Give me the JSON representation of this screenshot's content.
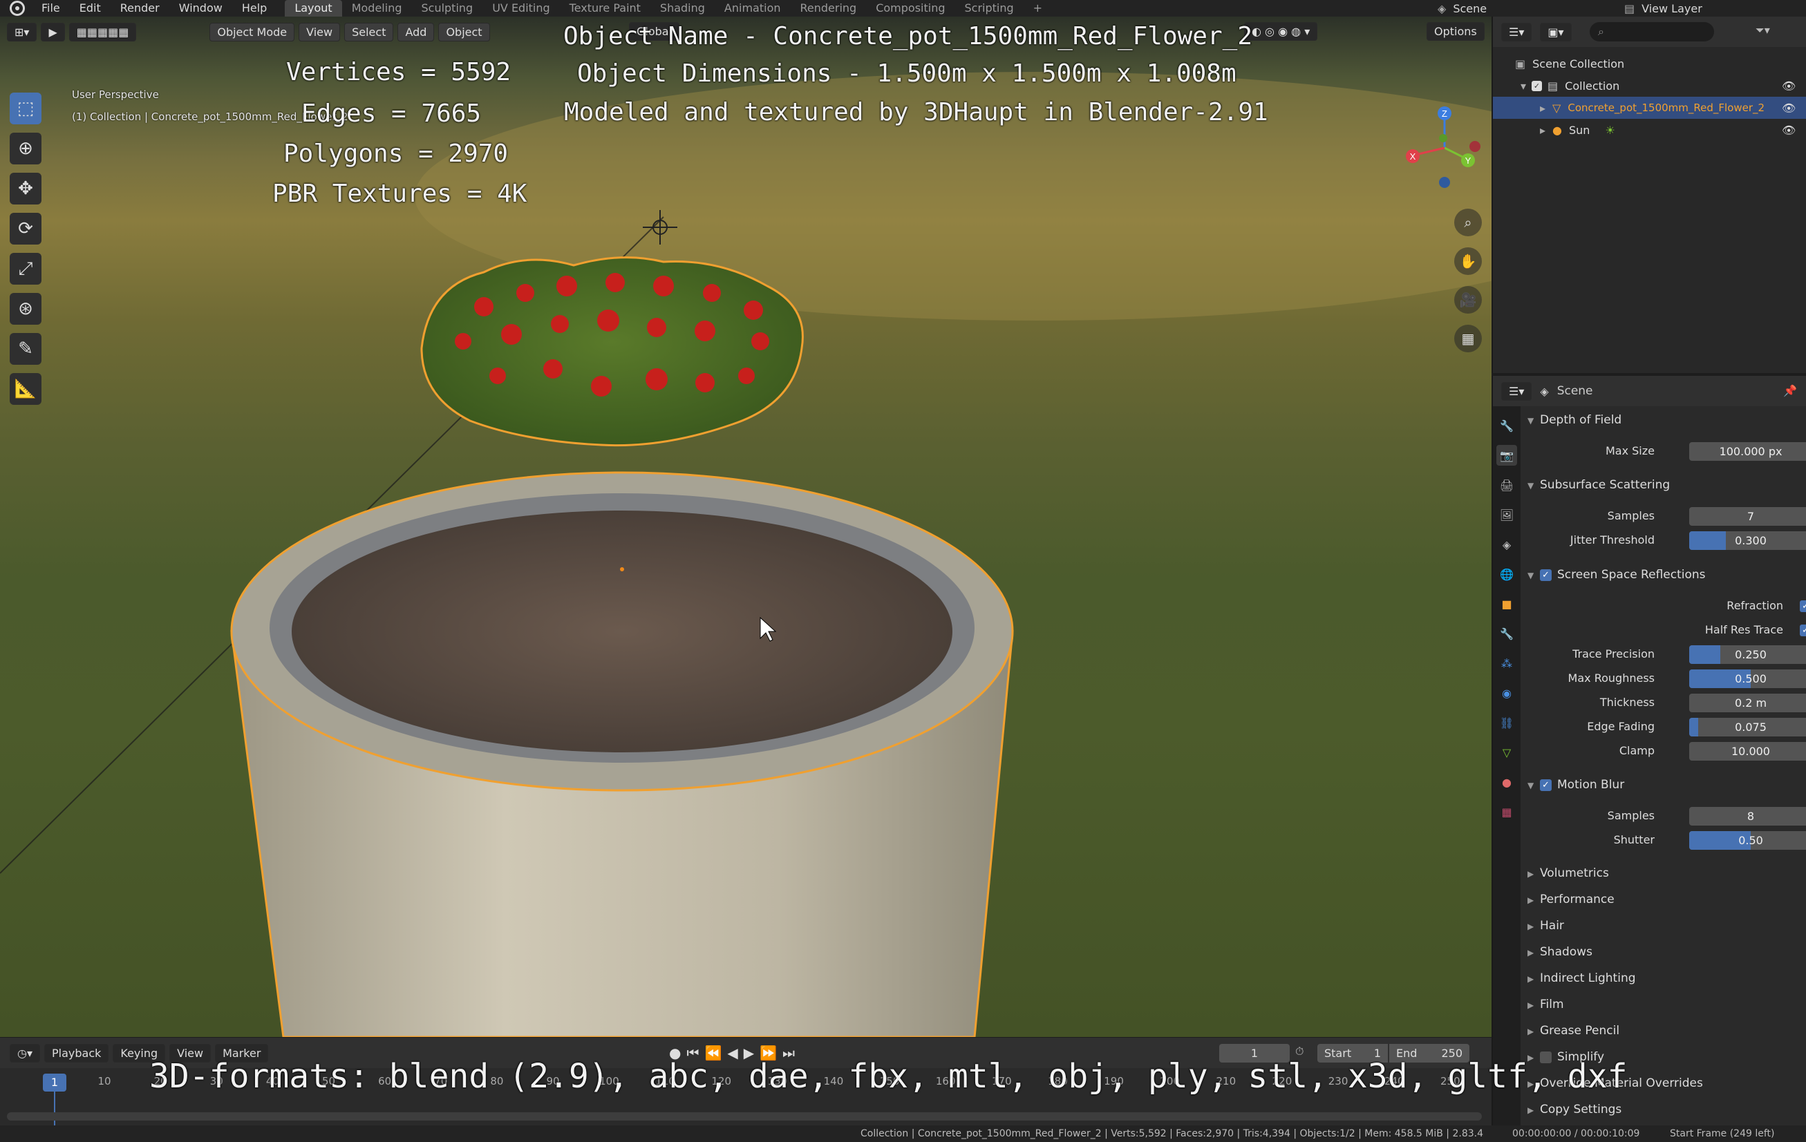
{
  "menu": [
    "File",
    "Edit",
    "Render",
    "Window",
    "Help"
  ],
  "workspaces": [
    "Layout",
    "Modeling",
    "Sculpting",
    "UV Editing",
    "Texture Paint",
    "Shading",
    "Animation",
    "Rendering",
    "Compositing",
    "Scripting",
    "+"
  ],
  "top_right": {
    "scene": "Scene",
    "view_layer": "View Layer"
  },
  "viewport": {
    "mode": "Object Mode",
    "header_menus": [
      "View",
      "Select",
      "Add",
      "Object"
    ],
    "transform_orientation": "Global",
    "options": "Options",
    "perspective": "User Perspective",
    "collection_path": "(1) Collection | Concrete_pot_1500mm_Red_Flower_2"
  },
  "overlay": {
    "object_name": "Object Name - Concrete_pot_1500mm_Red_Flower_2",
    "dimensions": "Object Dimensions -  1.500m x 1.500m x 1.008m",
    "credits": "Modeled and textured by 3DHaupt in Blender-2.91",
    "vertices": "Vertices = 5592",
    "edges": "Edges = 7665",
    "polygons": "Polygons = 2970",
    "textures": "PBR Textures = 4K",
    "formats": "3D-formats: blend (2.9), abc, dae, fbx, mtl, obj, ply, stl, x3d, gltf, dxf"
  },
  "gizmo": {
    "x": "X",
    "y": "Y",
    "z": "Z"
  },
  "outliner": {
    "root": "Scene Collection",
    "collection": "Collection",
    "items": [
      "Concrete_pot_1500mm_Red_Flower_2",
      "Sun"
    ]
  },
  "properties": {
    "context": "Scene",
    "dof": {
      "title": "Depth of Field",
      "max_size_label": "Max Size",
      "max_size": "100.000 px"
    },
    "sss": {
      "title": "Subsurface Scattering",
      "samples_label": "Samples",
      "samples": "7",
      "jitter_label": "Jitter Threshold",
      "jitter": "0.300",
      "jitter_fraction": 0.3
    },
    "ssr": {
      "title": "Screen Space Reflections",
      "refraction": "Refraction",
      "half_res": "Half Res Trace",
      "trace_precision_label": "Trace Precision",
      "trace_precision": "0.250",
      "trace_precision_fraction": 0.25,
      "max_roughness_label": "Max Roughness",
      "max_roughness": "0.500",
      "max_roughness_fraction": 0.5,
      "thickness_label": "Thickness",
      "thickness": "0.2 m",
      "edge_fading_label": "Edge Fading",
      "edge_fading": "0.075",
      "edge_fading_fraction": 0.075,
      "clamp_label": "Clamp",
      "clamp": "10.000"
    },
    "motion_blur": {
      "title": "Motion Blur",
      "samples_label": "Samples",
      "samples": "8",
      "shutter_label": "Shutter",
      "shutter": "0.50",
      "shutter_fraction": 0.5
    },
    "collapsed": [
      "Volumetrics",
      "Performance",
      "Hair",
      "Shadows",
      "Indirect Lighting",
      "Film",
      "Grease Pencil",
      "Simplify",
      "Override Material Overrides",
      "Copy Settings"
    ]
  },
  "timeline": {
    "menus": [
      "Playback",
      "Keying",
      "View",
      "Marker"
    ],
    "current_frame": "1",
    "start_label": "Start",
    "start": "1",
    "end_label": "End",
    "end": "250",
    "ticks": [
      "1",
      "10",
      "20",
      "30",
      "40",
      "50",
      "60",
      "70",
      "80",
      "90",
      "100",
      "110",
      "120",
      "130",
      "140",
      "150",
      "160",
      "170",
      "180",
      "190",
      "200",
      "210",
      "220",
      "230",
      "240",
      "250"
    ]
  },
  "status": {
    "left": "Collection | Concrete_pot_1500mm_Red_Flower_2 | Verts:5,592 | Faces:2,970 | Tris:4,394 | Objects:1/2 | Mem: 458.5 MiB | 2.83.4",
    "time": "00:00:00:00 / 00:00:10:09",
    "frame": "Start Frame (249 left)"
  }
}
